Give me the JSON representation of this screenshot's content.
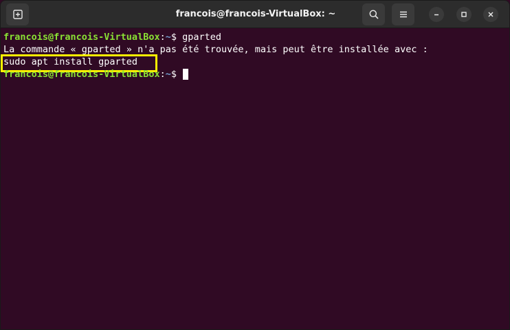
{
  "window": {
    "title": "francois@francois-VirtualBox: ~"
  },
  "titlebar": {
    "new_tab_icon": "new-tab-icon",
    "search_icon": "search-icon",
    "menu_icon": "hamburger-menu-icon",
    "minimize_icon": "minimize-icon",
    "maximize_icon": "maximize-icon",
    "close_icon": "close-icon"
  },
  "terminal": {
    "line1": {
      "user_host": "francois@francois-VirtualBox",
      "colon": ":",
      "path": "~",
      "dollar": "$ ",
      "command": "gparted"
    },
    "line2": "La commande « gparted » n'a pas été trouvée, mais peut être installée avec :",
    "line3": "sudo apt install gparted",
    "line4": {
      "user_host": "francois@francois-VirtualBox",
      "colon": ":",
      "path": "~",
      "dollar": "$ "
    }
  },
  "colors": {
    "background": "#300a24",
    "prompt_user": "#8ae234",
    "prompt_path": "#729fcf",
    "highlight_box": "#fff200",
    "titlebar": "#2c2c2c"
  }
}
